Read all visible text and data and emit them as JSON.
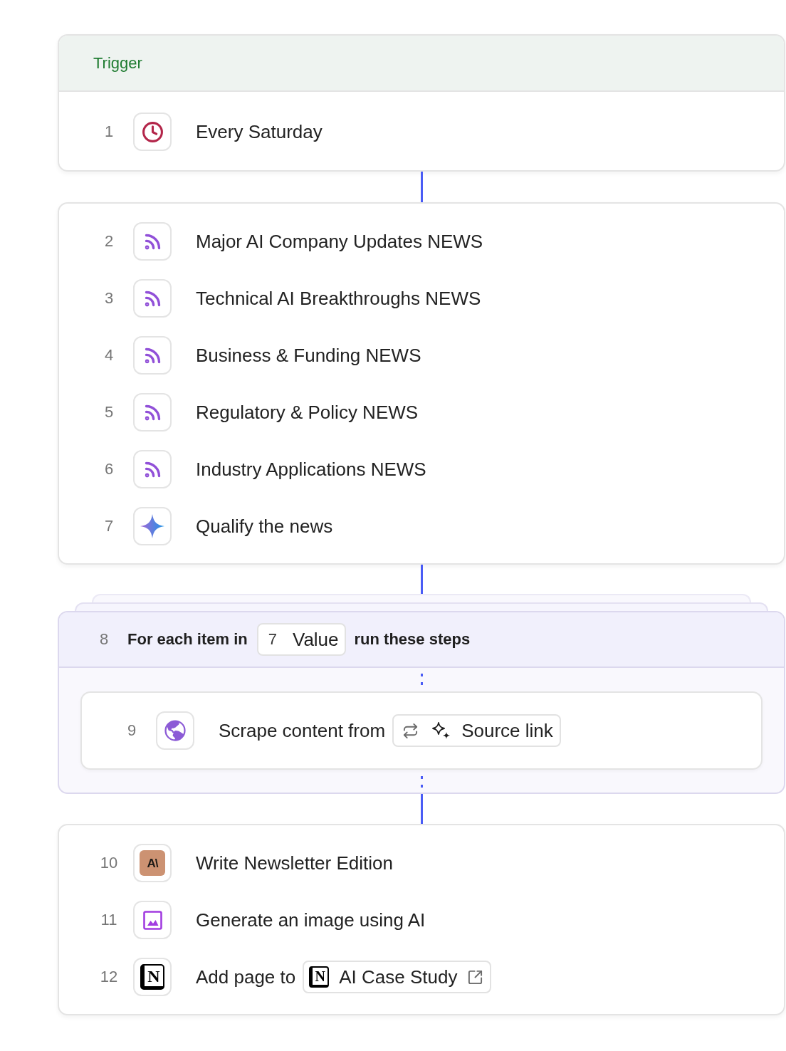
{
  "sections": [
    {
      "kind": "trigger",
      "title": "Trigger",
      "steps": [
        {
          "number": "1",
          "kind": "schedule",
          "title": "Every Saturday"
        }
      ]
    },
    {
      "kind": "steps",
      "steps": [
        {
          "number": "2",
          "kind": "feed",
          "title": "Major AI Company Updates NEWS"
        },
        {
          "number": "3",
          "kind": "feed",
          "title": "Technical AI Breakthroughs NEWS"
        },
        {
          "number": "4",
          "kind": "feed",
          "title": "Business & Funding NEWS"
        },
        {
          "number": "5",
          "kind": "feed",
          "title": "Regulatory & Policy NEWS"
        },
        {
          "number": "6",
          "kind": "feed",
          "title": "Industry Applications NEWS"
        },
        {
          "number": "7",
          "kind": "ai",
          "title": "Qualify the news"
        }
      ]
    },
    {
      "kind": "loop",
      "number": "8",
      "prefix": "For each item in",
      "source": {
        "number": "7",
        "label": "Value"
      },
      "suffix": "run these steps",
      "steps": [
        {
          "number": "9",
          "kind": "scrape",
          "title": "Scrape content from",
          "chip": {
            "kind": "variable",
            "label": "Source link"
          }
        }
      ]
    },
    {
      "kind": "steps",
      "steps": [
        {
          "number": "10",
          "kind": "writer",
          "logo": "A\\",
          "title": "Write Newsletter Edition"
        },
        {
          "number": "11",
          "kind": "image",
          "title": "Generate an image using AI"
        },
        {
          "number": "12",
          "kind": "page",
          "logo": "N",
          "title": "Add page to",
          "chip": {
            "kind": "page",
            "logo": "N",
            "label": "AI Case Study"
          }
        }
      ]
    }
  ]
}
